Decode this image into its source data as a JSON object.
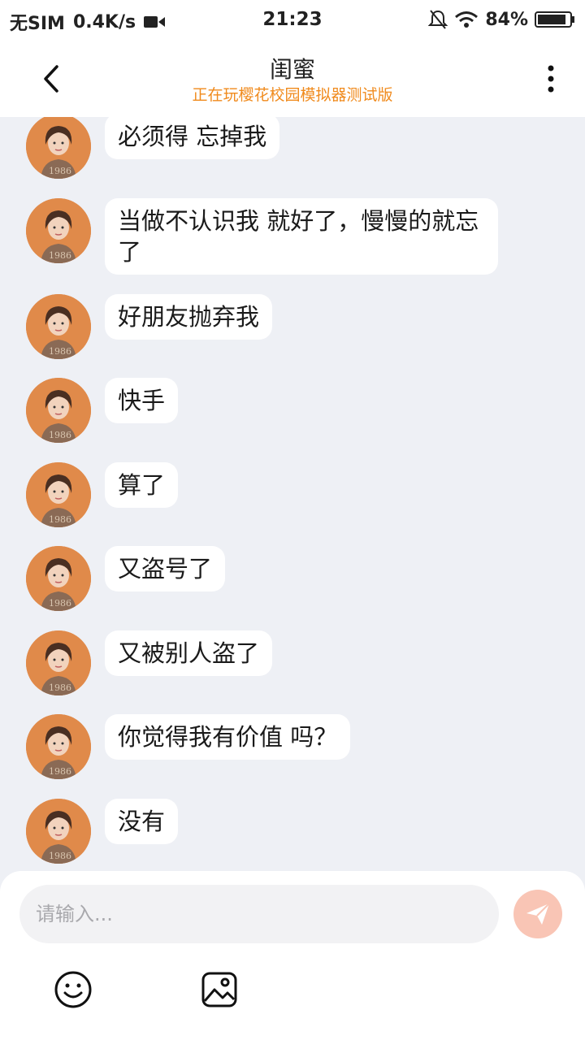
{
  "status_bar": {
    "carrier": "无SIM",
    "speed": "0.4K/s",
    "time": "21:23",
    "battery": "84%"
  },
  "header": {
    "title": "闺蜜",
    "subtitle": "正在玩樱花校园模拟器测试版",
    "back_icon": "chevron-left-icon",
    "more_icon": "more-vertical-icon"
  },
  "messages": [
    {
      "text": "必须得 忘掉我"
    },
    {
      "text": "当做不认识我 就好了，慢慢的就忘了"
    },
    {
      "text": "好朋友抛弃我"
    },
    {
      "text": "快手"
    },
    {
      "text": "算了"
    },
    {
      "text": "又盗号了"
    },
    {
      "text": "又被别人盗了"
    },
    {
      "text": "你觉得我有价值 吗？"
    },
    {
      "text": "没有"
    }
  ],
  "composer": {
    "placeholder": "请输入...",
    "value": "",
    "send_icon": "send-icon",
    "emoji_icon": "emoji-icon",
    "image_icon": "image-icon"
  },
  "colors": {
    "subtitle": "#f08a1c",
    "background": "#eef0f5",
    "send_button": "#f9c5b5",
    "avatar": "#e08a4a"
  }
}
